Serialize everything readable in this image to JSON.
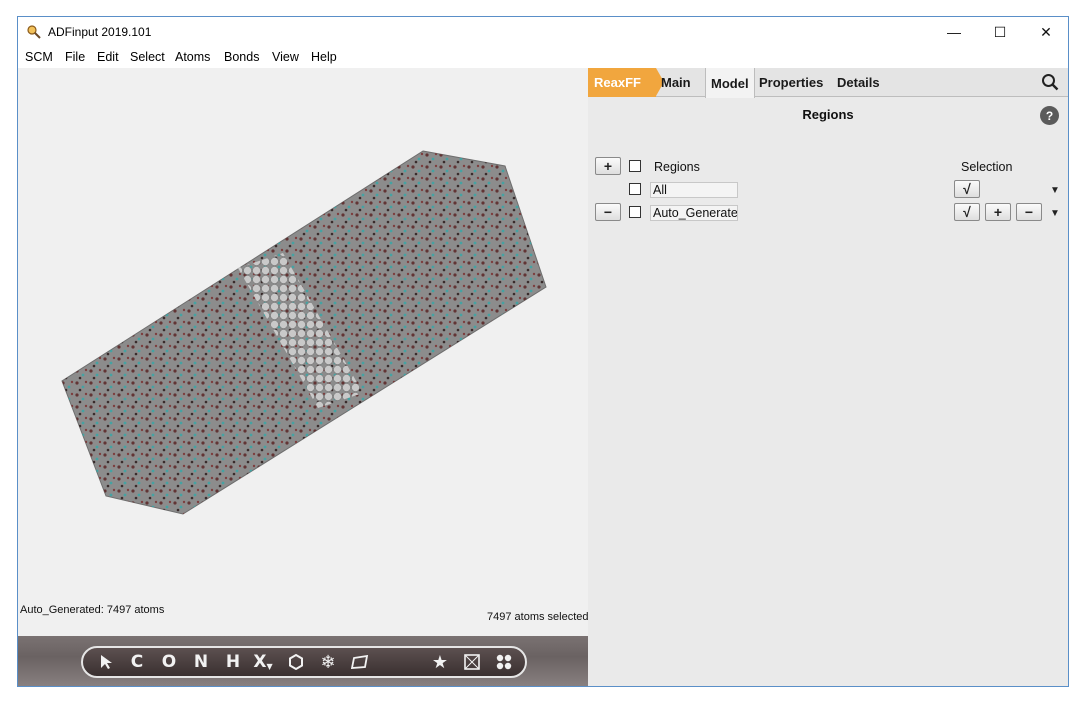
{
  "window": {
    "title": "ADFinput 2019.101",
    "controls": {
      "minimize": "—",
      "maximize": "☐",
      "close": "✕"
    }
  },
  "menu": [
    "SCM",
    "File",
    "Edit",
    "Select",
    "Atoms",
    "Bonds",
    "View",
    "Help"
  ],
  "viewport": {
    "status_left": "Auto_Generated: 7497 atoms",
    "status_right": "7497 atoms selected"
  },
  "toolbar": {
    "tools": [
      "select-arrow",
      "C",
      "O",
      "N",
      "H",
      "X",
      "ring",
      "snowflake",
      "plane",
      "star",
      "box",
      "cluster"
    ]
  },
  "tabs": {
    "reaxff": "ReaxFF",
    "main": "Main",
    "model": "Model",
    "properties": "Properties",
    "details": "Details"
  },
  "regions_panel": {
    "title": "Regions",
    "help": "?",
    "col_regions": "Regions",
    "col_selection": "Selection",
    "add_btn": "+",
    "remove_btn": "−",
    "rows": [
      {
        "name": "All",
        "check": "√"
      },
      {
        "name": "Auto_Generated",
        "check": "√",
        "plus": "+",
        "minus": "−"
      }
    ]
  },
  "colors": {
    "accent_tab": "#f1a63e",
    "cell_gray": "#8c8c8c",
    "window_border": "#5a8fc8"
  }
}
